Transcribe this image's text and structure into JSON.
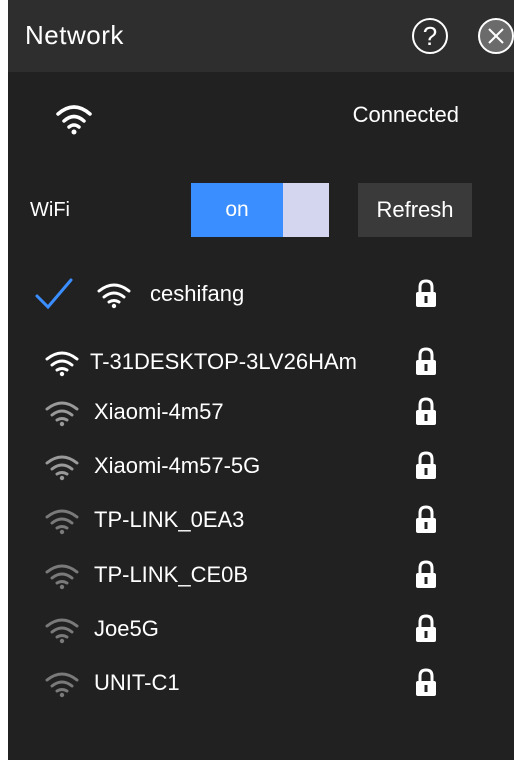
{
  "header": {
    "title": "Network",
    "help_label": "?"
  },
  "status": {
    "text": "Connected",
    "icon": "wifi-icon"
  },
  "wifi": {
    "label": "WiFi",
    "toggle_label": "on",
    "refresh_label": "Refresh"
  },
  "networks": [
    {
      "name": "ceshifang",
      "connected": true,
      "signal_color": "#ffffff",
      "locked": true
    },
    {
      "name": "T-31DESKTOP-3LV26HAm",
      "connected": false,
      "signal_color": "#ffffff",
      "locked": true
    },
    {
      "name": "Xiaomi-4m57",
      "connected": false,
      "signal_color": "#9a9a9a",
      "locked": true
    },
    {
      "name": "Xiaomi-4m57-5G",
      "connected": false,
      "signal_color": "#9a9a9a",
      "locked": true
    },
    {
      "name": "TP-LINK_0EA3",
      "connected": false,
      "signal_color": "#7a7a7a",
      "locked": true
    },
    {
      "name": "TP-LINK_CE0B",
      "connected": false,
      "signal_color": "#7a7a7a",
      "locked": true
    },
    {
      "name": "Joe5G",
      "connected": false,
      "signal_color": "#7a7a7a",
      "locked": true
    },
    {
      "name": "UNIT-C1",
      "connected": false,
      "signal_color": "#7a7a7a",
      "locked": true
    }
  ],
  "colors": {
    "accent": "#3a8eff",
    "check": "#3a8eff"
  }
}
